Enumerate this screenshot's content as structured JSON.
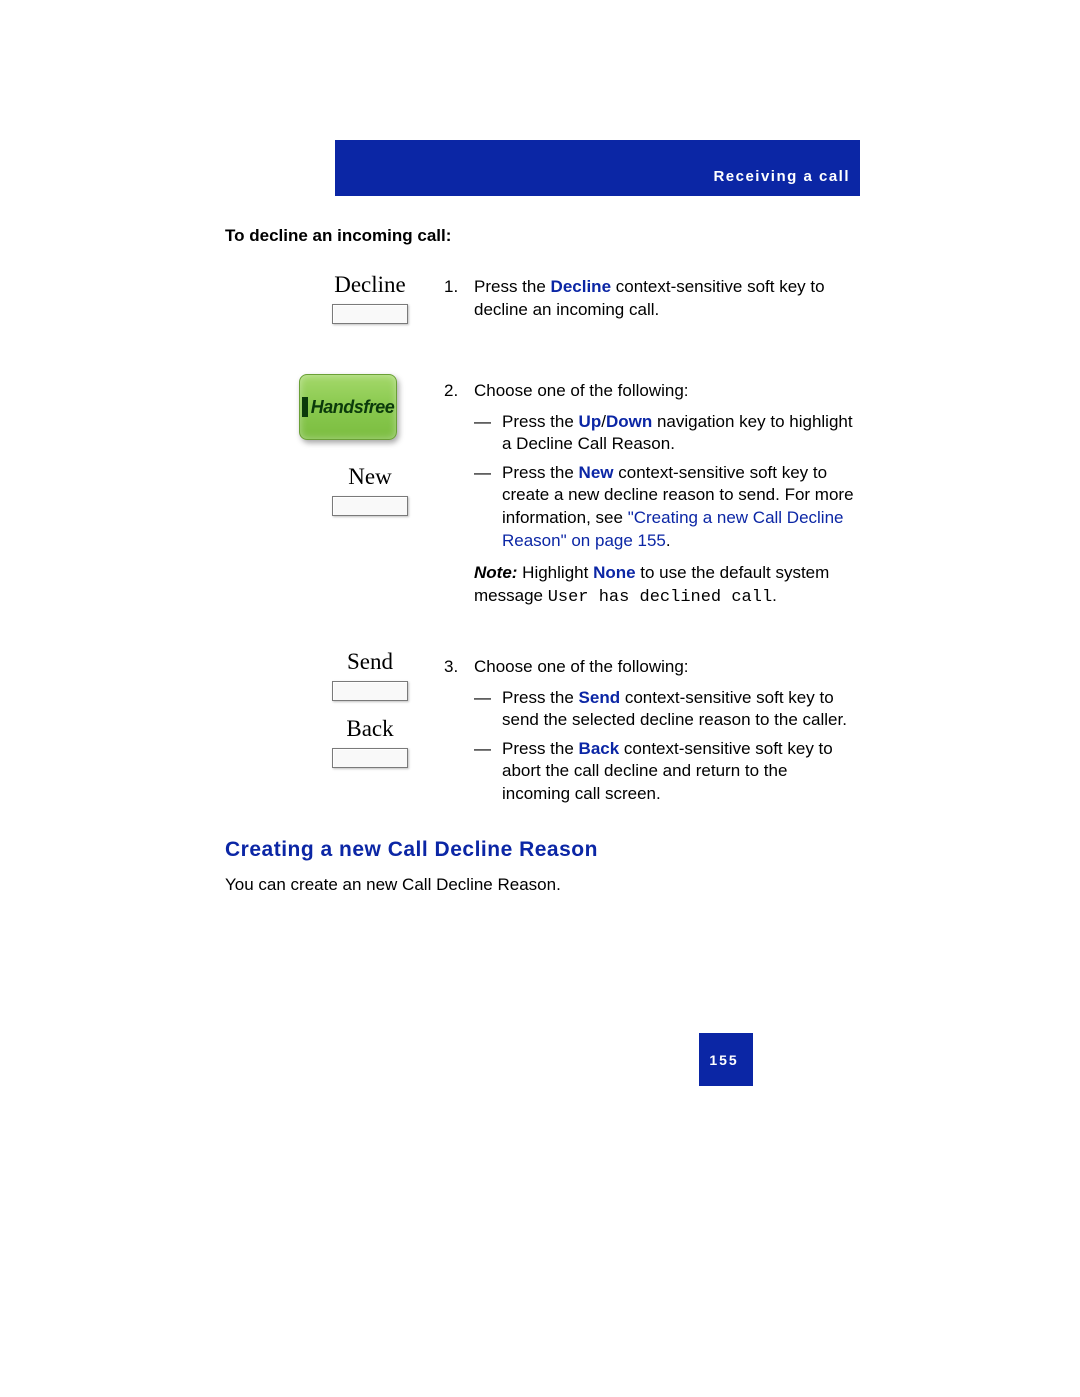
{
  "header": {
    "section": "Receiving  a  call"
  },
  "subhead": "To decline an incoming call:",
  "keys": {
    "decline": "Decline",
    "new": "New",
    "send": "Send",
    "back": "Back",
    "handsfree": "Handsfree"
  },
  "step1": {
    "num": "1.",
    "pre": "Press the ",
    "kw": "Decline",
    "post": " context-sensitive soft key to decline an incoming call."
  },
  "step2": {
    "num": "2.",
    "intro": "Choose one of the following:",
    "dash": "—",
    "a_pre": "Press the ",
    "a_kw": "Up",
    "a_slash": "/",
    "a_kw2": "Down",
    "a_post": " navigation key to highlight a Decline Call Reason.",
    "b_pre": "Press the ",
    "b_kw": "New",
    "b_post": " context-sensitive soft key to create a new decline reason to send. For more information, see ",
    "b_link": "\"Creating a new Call Decline Reason\" on page 155",
    "b_end": ".",
    "note_label": "Note:",
    "note_pre": "  Highlight ",
    "note_kw": "None",
    "note_mid": " to use the default system message ",
    "note_msg": "User has declined call",
    "note_end": "."
  },
  "step3": {
    "num": "3.",
    "intro": "Choose one of the following:",
    "dash": "—",
    "a_pre": "Press the ",
    "a_kw": "Send",
    "a_post": " context-sensitive soft key to send the selected decline reason to the caller.",
    "b_pre": "Press the ",
    "b_kw": "Back",
    "b_post": " context-sensitive soft key to abort the call decline and return to the incoming call screen."
  },
  "h2": "Creating  a  new  Call Decline  Reason",
  "body": "You can create an new Call Decline Reason.",
  "pagenum": "155"
}
